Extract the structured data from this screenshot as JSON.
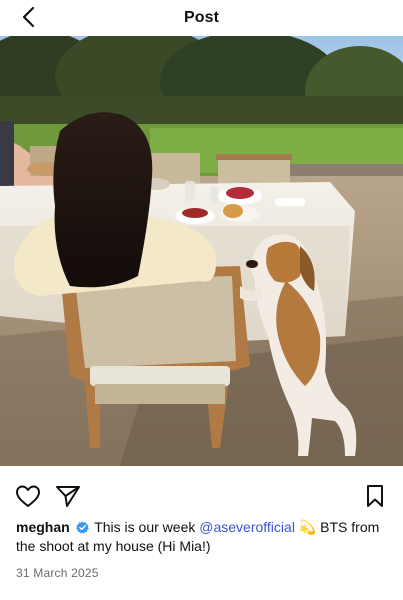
{
  "header": {
    "title": "Post",
    "back_icon": "chevron-left-icon"
  },
  "post": {
    "image_icon": "photo"
  },
  "actions": {
    "like_icon": "heart-icon",
    "share_icon": "send-icon",
    "save_icon": "bookmark-icon"
  },
  "caption": {
    "username": "meghan",
    "verified_color": "#3897f0",
    "text_before_mention": "This is our week",
    "mention": "@aseverofficial",
    "emoji": "💫",
    "text_after": "BTS from the shoot at my house (Hi Mia!)"
  },
  "date": "31 March 2025",
  "colors": {
    "mention": "#3a55d6",
    "date": "#6b6b6b"
  }
}
